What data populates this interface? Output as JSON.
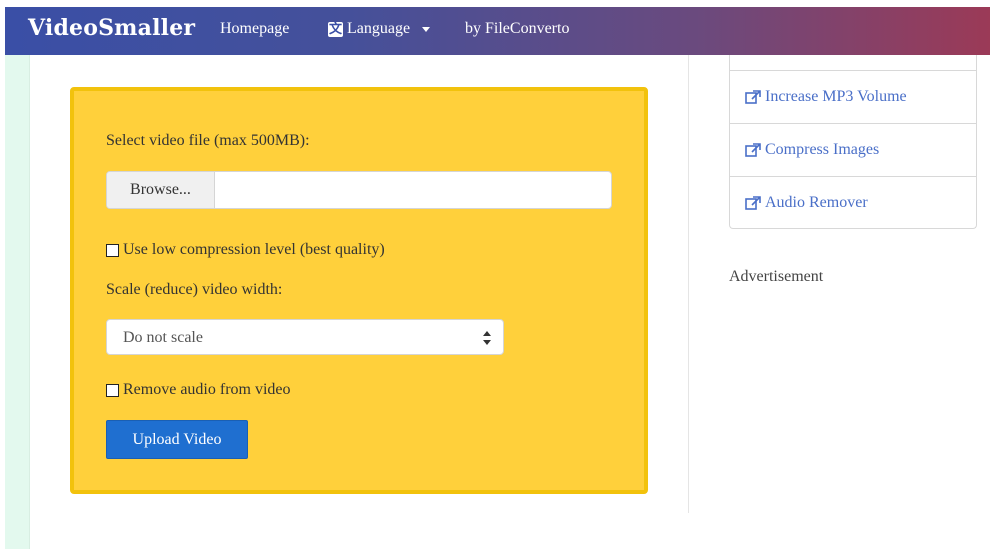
{
  "nav": {
    "brand": "VideoSmaller",
    "homepage": "Homepage",
    "language": "Language",
    "by": "by FileConverto"
  },
  "form": {
    "select_label": "Select video file (max 500MB):",
    "browse_label": "Browse...",
    "file_value": "",
    "low_compression_label": "Use low compression level (best quality)",
    "low_compression_checked": false,
    "scale_label": "Scale (reduce) video width:",
    "scale_selected": "Do not scale",
    "remove_audio_label": "Remove audio from video",
    "remove_audio_checked": false,
    "upload_label": "Upload Video"
  },
  "sidebar": {
    "items": [
      {
        "label": "Increase MP3 Volume",
        "icon": "external-link-icon"
      },
      {
        "label": "Compress Images",
        "icon": "external-link-icon"
      },
      {
        "label": "Audio Remover",
        "icon": "external-link-icon"
      }
    ],
    "advertisement": "Advertisement"
  },
  "colors": {
    "form_bg": "#ffd03b",
    "form_border": "#f2c20c",
    "upload_button": "#1f6fd0",
    "link": "#4a6fc8"
  }
}
